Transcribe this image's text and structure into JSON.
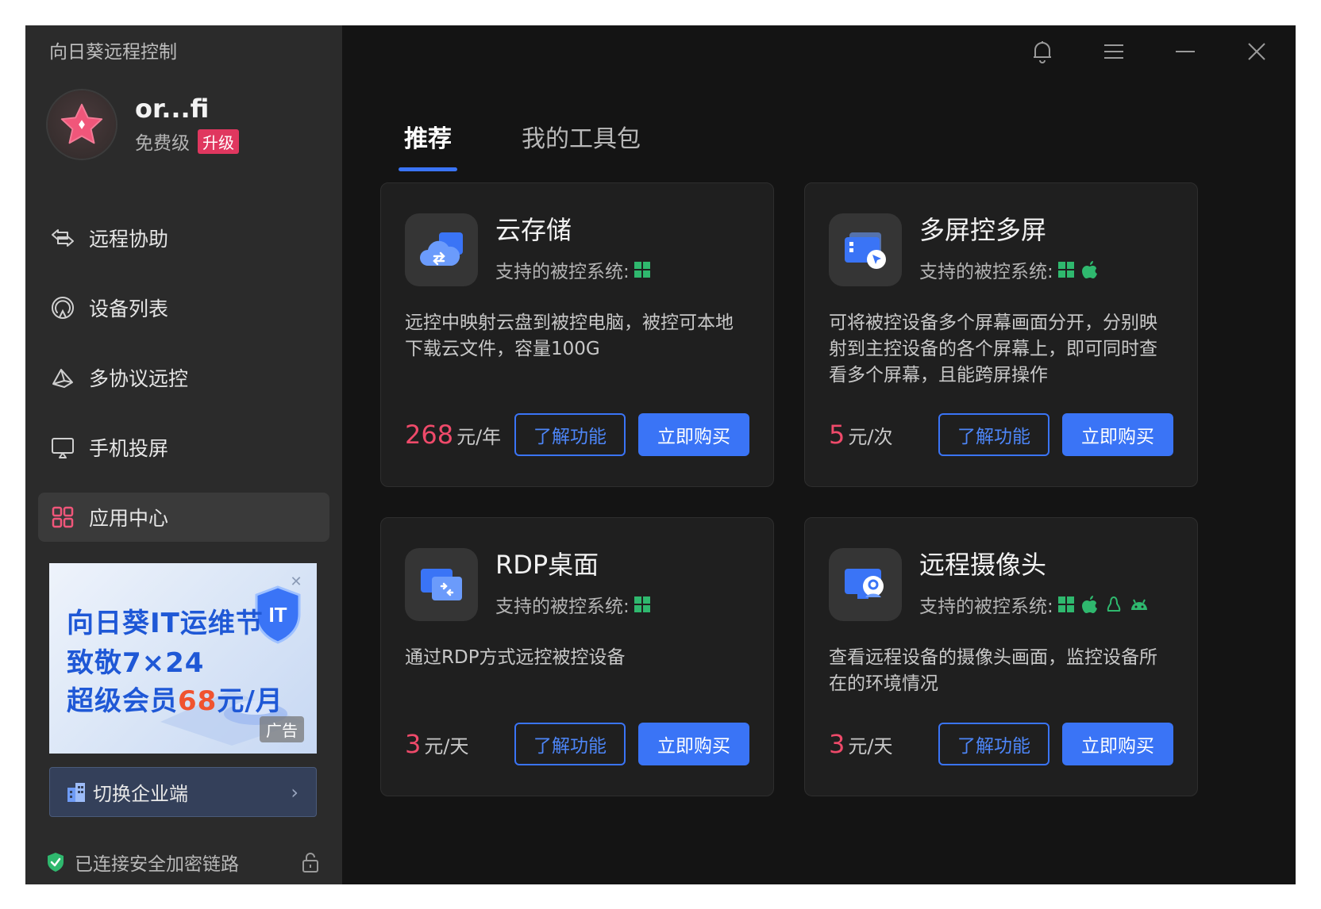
{
  "app": {
    "title": "向日葵远程控制"
  },
  "profile": {
    "username": "or...fi",
    "tier": "免费级",
    "upgrade_label": "升级"
  },
  "nav": {
    "items": [
      {
        "label": "远程协助",
        "icon": "remote-assist-icon"
      },
      {
        "label": "设备列表",
        "icon": "device-list-icon"
      },
      {
        "label": "多协议远控",
        "icon": "multi-protocol-icon"
      },
      {
        "label": "手机投屏",
        "icon": "screen-cast-icon"
      },
      {
        "label": "应用中心",
        "icon": "app-center-icon",
        "active": true
      }
    ]
  },
  "ad": {
    "line1": "向日葵IT运维节",
    "line2": "致敬7×24",
    "line3_pre": "超级会员",
    "line3_hl": "68",
    "line3_post": "元/月",
    "shield_text": "IT",
    "badge": "广告"
  },
  "switch_enterprise": {
    "label": "切换企业端"
  },
  "security": {
    "label": "已连接安全加密链路"
  },
  "tabs": [
    {
      "label": "推荐",
      "active": true
    },
    {
      "label": "我的工具包",
      "active": false
    }
  ],
  "cards": [
    {
      "title": "云存储",
      "support_label": "支持的被控系统:",
      "os": [
        "windows-icon"
      ],
      "desc": "远控中映射云盘到被控电脑，被控可本地下载云文件，容量100G",
      "price": "268",
      "unit": "元/年",
      "learn_label": "了解功能",
      "buy_label": "立即购买"
    },
    {
      "title": "多屏控多屏",
      "support_label": "支持的被控系统:",
      "os": [
        "windows-icon",
        "apple-icon"
      ],
      "desc": "可将被控设备多个屏幕画面分开，分别映射到主控设备的各个屏幕上，即可同时查看多个屏幕，且能跨屏操作",
      "price": "5",
      "unit": "元/次",
      "learn_label": "了解功能",
      "buy_label": "立即购买"
    },
    {
      "title": "RDP桌面",
      "support_label": "支持的被控系统:",
      "os": [
        "windows-icon"
      ],
      "desc": "通过RDP方式远控被控设备",
      "price": "3",
      "unit": "元/天",
      "learn_label": "了解功能",
      "buy_label": "立即购买"
    },
    {
      "title": "远程摄像头",
      "support_label": "支持的被控系统:",
      "os": [
        "windows-icon",
        "apple-icon",
        "linux-icon",
        "android-icon"
      ],
      "desc": "查看远程设备的摄像头画面，监控设备所在的环境情况",
      "price": "3",
      "unit": "元/天",
      "learn_label": "了解功能",
      "buy_label": "立即购买"
    }
  ],
  "colors": {
    "accent": "#3a74f6",
    "price": "#ef4a6a",
    "upgrade": "#e0375f",
    "secure": "#2fb86e"
  }
}
